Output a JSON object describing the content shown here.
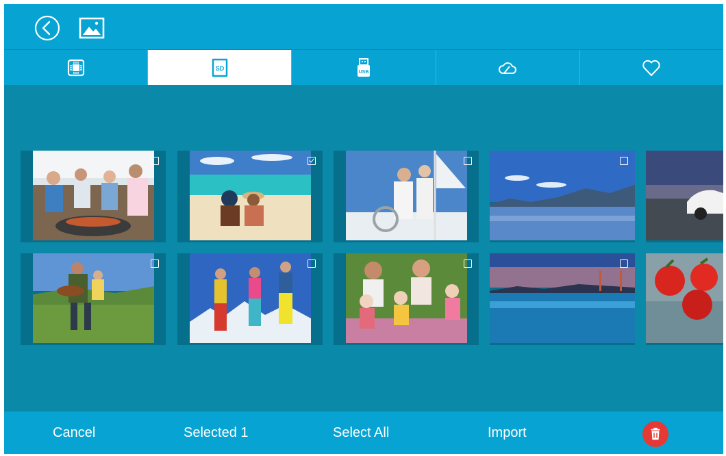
{
  "topbar": {
    "back_icon": "back-circle-icon",
    "gallery_icon": "image-gallery-icon"
  },
  "tabs": [
    {
      "icon": "internal-memory-icon",
      "active": false
    },
    {
      "icon": "sd-card-icon",
      "label": "SD",
      "active": true
    },
    {
      "icon": "usb-drive-icon",
      "label": "USB",
      "active": false
    },
    {
      "icon": "cloud-icon",
      "active": false
    },
    {
      "icon": "heart-icon",
      "active": false
    }
  ],
  "photos": [
    {
      "subject": "family barbecue",
      "checked": false
    },
    {
      "subject": "couple on beach",
      "checked": true
    },
    {
      "subject": "couple sailing",
      "checked": false
    },
    {
      "subject": "mountain lake",
      "checked": false
    },
    {
      "subject": "car at night",
      "checked": false
    },
    {
      "subject": "man playing guitar",
      "checked": false
    },
    {
      "subject": "skiers jumping",
      "checked": false
    },
    {
      "subject": "girls having picnic",
      "checked": false
    },
    {
      "subject": "bridge at dusk",
      "checked": false
    },
    {
      "subject": "tomatoes",
      "checked": false
    }
  ],
  "bottombar": {
    "cancel": "Cancel",
    "selected": "Selected 1",
    "select_all": "Select All",
    "import": "Import",
    "delete_icon": "trash-icon"
  },
  "colors": {
    "bar": "#06a3d3",
    "background": "#0a89a8",
    "tile": "#066f8c",
    "delete": "#e53935"
  }
}
